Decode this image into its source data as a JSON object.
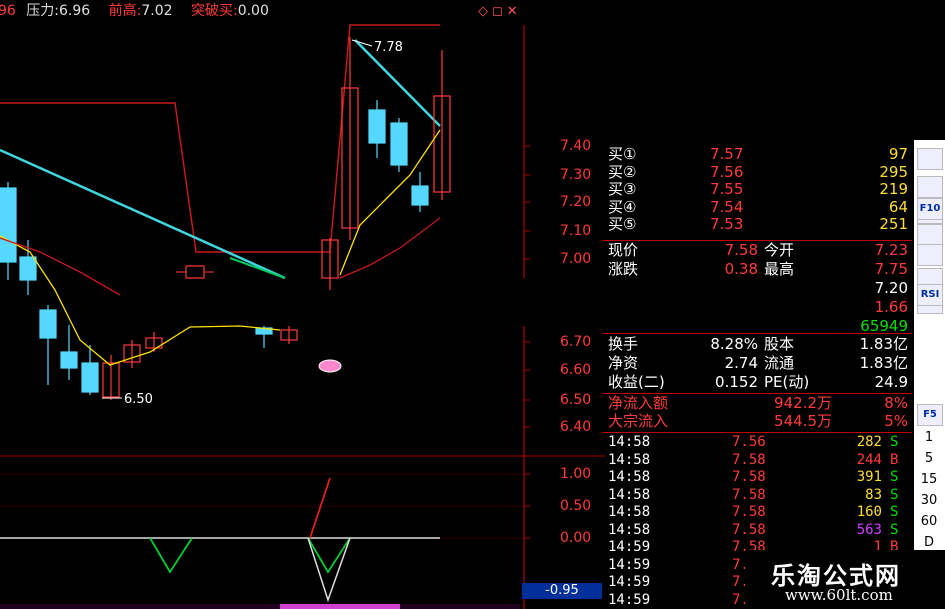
{
  "header": {
    "partial": "96",
    "pressure_label": "压力:",
    "pressure_value": "6.96",
    "prev_high_label": "前高:",
    "prev_high_value": "7.02",
    "breakout_label": "突破买:",
    "breakout_value": "0.00",
    "window_buttons": "◇◻✕"
  },
  "price_axis": [
    "7.40",
    "7.30",
    "7.20",
    "7.10",
    "7.00",
    "6.70",
    "6.60",
    "6.50",
    "6.40"
  ],
  "indicator_axis": [
    "1.00",
    "0.50",
    "0.00"
  ],
  "indicator_value": "-0.95",
  "annotations": {
    "high": "7.78",
    "low": "6.50"
  },
  "order_book": {
    "bids": [
      {
        "label": "买①",
        "price": "7.57",
        "vol": "97"
      },
      {
        "label": "买②",
        "price": "7.56",
        "vol": "295"
      },
      {
        "label": "买③",
        "price": "7.55",
        "vol": "219"
      },
      {
        "label": "买④",
        "price": "7.54",
        "vol": "64"
      },
      {
        "label": "买⑤",
        "price": "7.53",
        "vol": "251"
      }
    ]
  },
  "quote": {
    "now_label": "现价",
    "now": "7.58",
    "open_label": "今开",
    "open": "7.23",
    "chg_label": "涨跌",
    "chg": "0.38",
    "high_label": "最高",
    "high": "7.75",
    "low": "7.20",
    "x1": "1.66",
    "vol": "65949"
  },
  "fundamentals": [
    {
      "l1": "换手",
      "v1": "8.28%",
      "l2": "股本",
      "v2": "1.83亿"
    },
    {
      "l1": "净资",
      "v1": "2.74",
      "l2": "流通",
      "v2": "1.83亿"
    },
    {
      "l1": "收益(二)",
      "v1": "0.152",
      "l2": "PE(动)",
      "v2": "24.9"
    }
  ],
  "flows": [
    {
      "label": "净流入额",
      "amount": "942.2万",
      "pct": "8%"
    },
    {
      "label": "大宗流入",
      "amount": "544.5万",
      "pct": "5%"
    }
  ],
  "ticks": [
    {
      "t": "14:58",
      "p": "7.56",
      "v": "282",
      "s": "S"
    },
    {
      "t": "14:58",
      "p": "7.58",
      "v": "244",
      "s": "B"
    },
    {
      "t": "14:58",
      "p": "7.58",
      "v": "391",
      "s": "S"
    },
    {
      "t": "14:58",
      "p": "7.58",
      "v": "83",
      "s": "S"
    },
    {
      "t": "14:58",
      "p": "7.58",
      "v": "160",
      "s": "S"
    },
    {
      "t": "14:58",
      "p": "7.58",
      "v": "563",
      "s": "S"
    },
    {
      "t": "14:59",
      "p": "7.58",
      "v": "1",
      "s": "B"
    },
    {
      "t": "14:59",
      "p": "7.",
      "v": "",
      "s": ""
    },
    {
      "t": "14:59",
      "p": "7.",
      "v": "",
      "s": ""
    },
    {
      "t": "14:59",
      "p": "7.",
      "v": "",
      "s": ""
    }
  ],
  "toolbar": {
    "buttons": [
      "F10",
      "RSI",
      "F5"
    ],
    "periods": [
      "1",
      "5",
      "15",
      "30",
      "60",
      "D"
    ]
  },
  "watermark": {
    "cn": "乐淘公式网",
    "url": "www.60lt.com"
  },
  "colors": {
    "up": "#ff3b3b",
    "down": "#54d8ff",
    "ma_yellow": "#ffe000",
    "ma_red": "#c41a1a",
    "trend": "#3fd6e0",
    "grid": "#a00000"
  }
}
